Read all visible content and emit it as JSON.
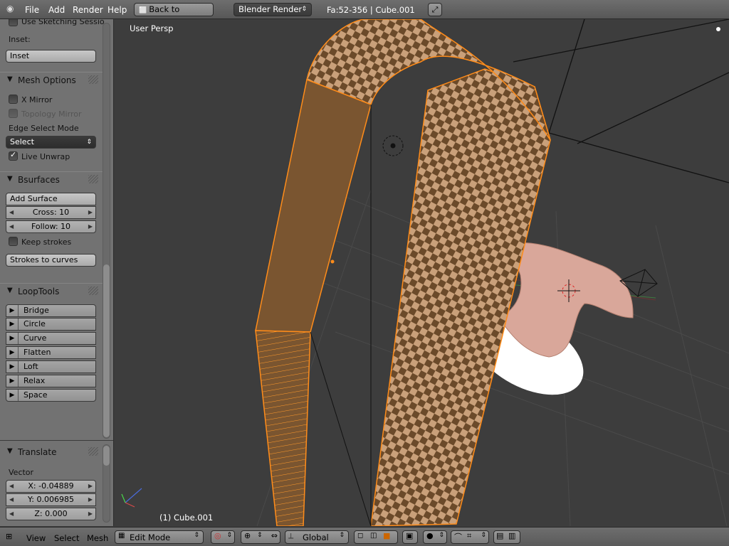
{
  "header": {
    "menus": [
      "File",
      "Add",
      "Render",
      "Help"
    ],
    "back_button": "Back to Previous",
    "render_engine": "Blender Render",
    "stats": "Fa:52-356 | Cube.001"
  },
  "toolshelf": {
    "top_partial": "Use Sketching Sessio",
    "inset_label": "Inset:",
    "inset_button": "Inset",
    "mesh_options": {
      "title": "Mesh Options",
      "x_mirror": "X Mirror",
      "topology_mirror": "Topology Mirror",
      "edge_select_label": "Edge Select Mode",
      "edge_select_value": "Select",
      "live_unwrap": "Live Unwrap"
    },
    "bsurfaces": {
      "title": "Bsurfaces",
      "add_surface": "Add Surface",
      "cross": "Cross: 10",
      "follow": "Follow: 10",
      "keep_strokes": "Keep strokes",
      "strokes_to_curves": "Strokes to curves"
    },
    "looptools": {
      "title": "LoopTools",
      "items": [
        "Bridge",
        "Circle",
        "Curve",
        "Flatten",
        "Loft",
        "Relax",
        "Space"
      ]
    },
    "translate": {
      "title": "Translate",
      "vector_label": "Vector",
      "x": "X: -0.04889",
      "y": "Y: 0.006985",
      "z": "Z: 0.000"
    }
  },
  "viewport": {
    "view_name": "User Persp",
    "object_name": "(1) Cube.001"
  },
  "bottombar": {
    "menus": [
      "View",
      "Select",
      "Mesh"
    ],
    "mode": "Edit Mode",
    "orientation": "Global"
  },
  "colors": {
    "selection_orange": "#ff8c1a",
    "checker_light": "#c9a07a",
    "checker_dark": "#6b4a2a",
    "viewport_bg": "#3d3d3d"
  }
}
